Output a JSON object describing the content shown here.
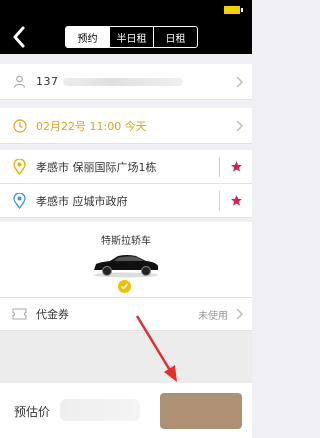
{
  "status_bar": {
    "battery_level": 1.0
  },
  "nav": {
    "back_icon": "back-chevron-icon",
    "tabs": [
      {
        "label": "预约",
        "active": true
      },
      {
        "label": "半日租",
        "active": false
      },
      {
        "label": "日租",
        "active": false
      }
    ]
  },
  "form": {
    "phone": {
      "icon": "person-icon",
      "value": "137"
    },
    "time": {
      "icon": "clock-icon",
      "value": "02月22号 11:00 今天"
    },
    "start": {
      "icon": "location-pin-yellow-icon",
      "value": "孝感市  保丽国际广场1栋"
    },
    "destination": {
      "icon": "location-pin-blue-icon",
      "value": "孝感市  应城市政府"
    }
  },
  "car": {
    "name": "特斯拉轿车",
    "selected": true
  },
  "coupon": {
    "icon": "ticket-icon",
    "label": "代金券",
    "value": "未使用"
  },
  "bottom": {
    "estimate_label": "预估价"
  },
  "colors": {
    "accent": "#e0a020",
    "star": "#d61f5c",
    "nav_bg": "#000000",
    "check": "#f0c000",
    "arrow": "#e0302a"
  }
}
